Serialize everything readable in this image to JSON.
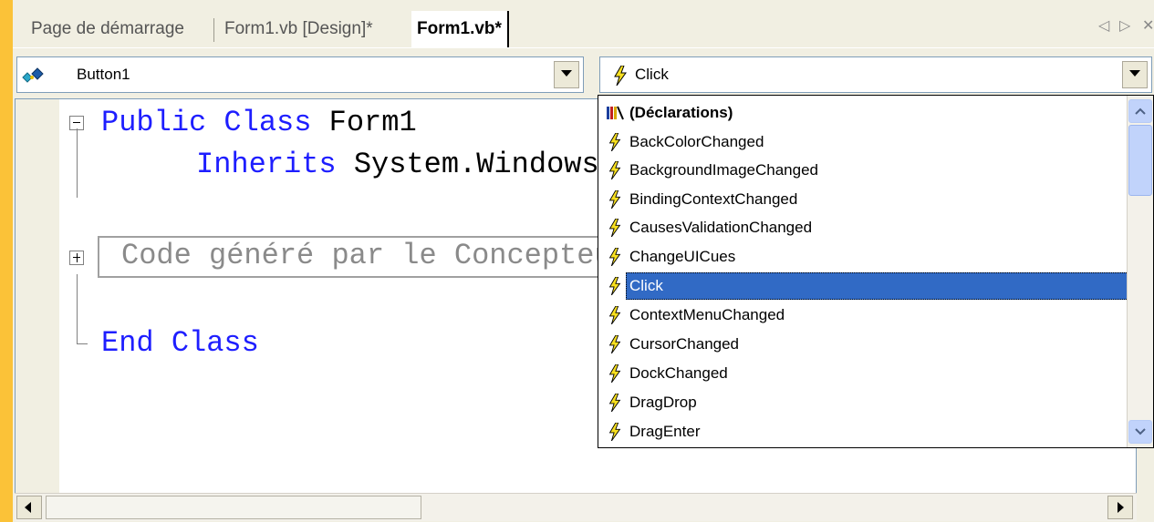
{
  "tabs": [
    {
      "label": "Page de démarrage"
    },
    {
      "label": "Form1.vb [Design]*"
    },
    {
      "label": "Form1.vb*"
    }
  ],
  "nav": {
    "object_combo": "Button1",
    "event_combo": "Click"
  },
  "code": {
    "line1_kw": "Public Class",
    "line1_rest": " Form1",
    "line2_kw": "Inherits",
    "line2_rest": " System.Windows.Forms.Form",
    "region_text": "Code généré par le Concepteur Windows Form",
    "line_end": "End Class"
  },
  "dropdown": {
    "items": [
      {
        "label": "(Déclarations)",
        "icon": "declarations-icon"
      },
      {
        "label": "BackColorChanged",
        "icon": "event-lightning-icon"
      },
      {
        "label": "BackgroundImageChanged",
        "icon": "event-lightning-icon"
      },
      {
        "label": "BindingContextChanged",
        "icon": "event-lightning-icon"
      },
      {
        "label": "CausesValidationChanged",
        "icon": "event-lightning-icon"
      },
      {
        "label": "ChangeUICues",
        "icon": "event-lightning-icon"
      },
      {
        "label": "Click",
        "icon": "event-lightning-icon",
        "selected": true
      },
      {
        "label": "ContextMenuChanged",
        "icon": "event-lightning-icon"
      },
      {
        "label": "CursorChanged",
        "icon": "event-lightning-icon"
      },
      {
        "label": "DockChanged",
        "icon": "event-lightning-icon"
      },
      {
        "label": "DragDrop",
        "icon": "event-lightning-icon"
      },
      {
        "label": "DragEnter",
        "icon": "event-lightning-icon"
      }
    ]
  },
  "colors": {
    "keyword": "#1e1eff",
    "selection": "#316ac5",
    "frame": "#fbc238"
  }
}
